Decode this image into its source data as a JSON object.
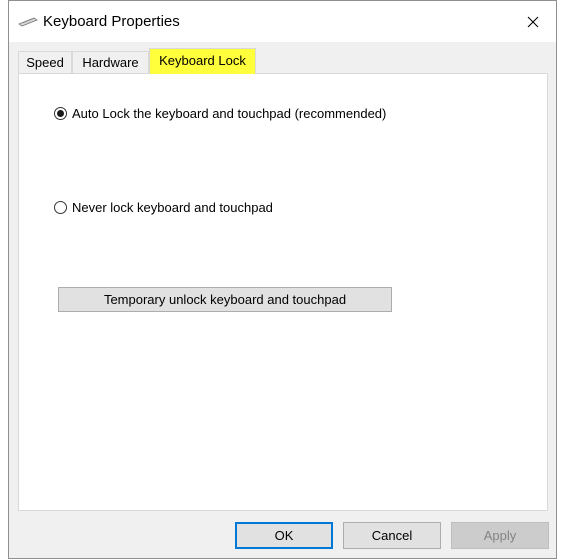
{
  "window": {
    "title": "Keyboard Properties",
    "close_glyph": "✕"
  },
  "tabs": [
    {
      "label": "Speed"
    },
    {
      "label": "Hardware"
    },
    {
      "label": "Keyboard Lock"
    }
  ],
  "options": {
    "auto_lock_label": "Auto Lock the keyboard and touchpad (recommended)",
    "never_lock_label": "Never lock keyboard and touchpad"
  },
  "unlock_button_label": "Temporary unlock keyboard and touchpad",
  "buttons": {
    "ok": "OK",
    "cancel": "Cancel",
    "apply": "Apply"
  },
  "colors": {
    "highlight": "#ffff3c",
    "focus": "#0078d7"
  }
}
